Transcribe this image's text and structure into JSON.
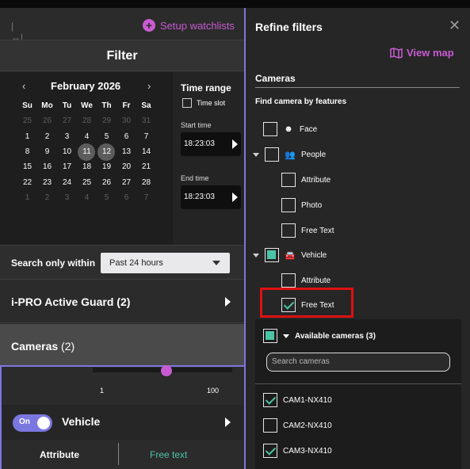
{
  "left": {
    "setup_label": "Setup watchlists",
    "filter_title": "Filter",
    "calendar": {
      "prev": "‹",
      "month": "February 2026",
      "next": "›",
      "weekdays": [
        "Su",
        "Mo",
        "Tu",
        "We",
        "Th",
        "Fr",
        "Sa"
      ],
      "weeks": [
        [
          {
            "d": "25",
            "dim": true
          },
          {
            "d": "26",
            "dim": true
          },
          {
            "d": "27",
            "dim": true
          },
          {
            "d": "28",
            "dim": true
          },
          {
            "d": "29",
            "dim": true
          },
          {
            "d": "30",
            "dim": true
          },
          {
            "d": "31",
            "dim": true
          }
        ],
        [
          {
            "d": "1"
          },
          {
            "d": "2"
          },
          {
            "d": "3"
          },
          {
            "d": "4"
          },
          {
            "d": "5"
          },
          {
            "d": "6"
          },
          {
            "d": "7"
          }
        ],
        [
          {
            "d": "8"
          },
          {
            "d": "9"
          },
          {
            "d": "10"
          },
          {
            "d": "11",
            "sel": true
          },
          {
            "d": "12",
            "sel": true
          },
          {
            "d": "13"
          },
          {
            "d": "14"
          }
        ],
        [
          {
            "d": "15"
          },
          {
            "d": "16"
          },
          {
            "d": "17"
          },
          {
            "d": "18"
          },
          {
            "d": "19"
          },
          {
            "d": "20"
          },
          {
            "d": "21"
          }
        ],
        [
          {
            "d": "22"
          },
          {
            "d": "23"
          },
          {
            "d": "24"
          },
          {
            "d": "25"
          },
          {
            "d": "26"
          },
          {
            "d": "27"
          },
          {
            "d": "28"
          }
        ],
        [
          {
            "d": "1",
            "dim": true
          },
          {
            "d": "2",
            "dim": true
          },
          {
            "d": "3",
            "dim": true
          },
          {
            "d": "4",
            "dim": true
          },
          {
            "d": "5",
            "dim": true
          },
          {
            "d": "6",
            "dim": true
          },
          {
            "d": "7",
            "dim": true
          }
        ]
      ]
    },
    "time_range": {
      "title": "Time range",
      "time_slot": "Time slot",
      "start_label": "Start time",
      "start_value": "18:23:03",
      "end_label": "End time",
      "end_value": "18:23:03"
    },
    "search_within": {
      "label": "Search only within",
      "value": "Past 24 hours"
    },
    "guard": {
      "label": "i-PRO Active Guard",
      "count": "(2)"
    },
    "cameras": {
      "label": "Cameras",
      "count": "(2)"
    },
    "slider": {
      "min": "1",
      "max": "100",
      "value_fraction": 0.5
    },
    "vehicle": {
      "toggle": "On",
      "label": "Vehicle"
    },
    "tabs": {
      "attribute": "Attribute",
      "free_text": "Free text"
    }
  },
  "right": {
    "title": "Refine filters",
    "close": "✕",
    "view_map": "View map",
    "section": "Cameras",
    "find_label": "Find camera by features",
    "features": {
      "face": "Face",
      "people": "People",
      "people_attribute": "Attribute",
      "people_photo": "Photo",
      "people_free_text": "Free Text",
      "vehicle": "Vehicle",
      "vehicle_attribute": "Attribute",
      "vehicle_free_text": "Free Text"
    },
    "available": {
      "label": "Available cameras (3)",
      "search_placeholder": "Search cameras",
      "cameras": [
        {
          "name": "CAM1-NX410",
          "checked": true
        },
        {
          "name": "CAM2-NX410",
          "checked": false
        },
        {
          "name": "CAM3-NX410",
          "checked": true
        }
      ]
    }
  },
  "colors": {
    "accent_purple": "#c85bd2",
    "accent_violet": "#7b77e0",
    "accent_teal": "#4bc4a6",
    "highlight_red": "#e01010"
  }
}
